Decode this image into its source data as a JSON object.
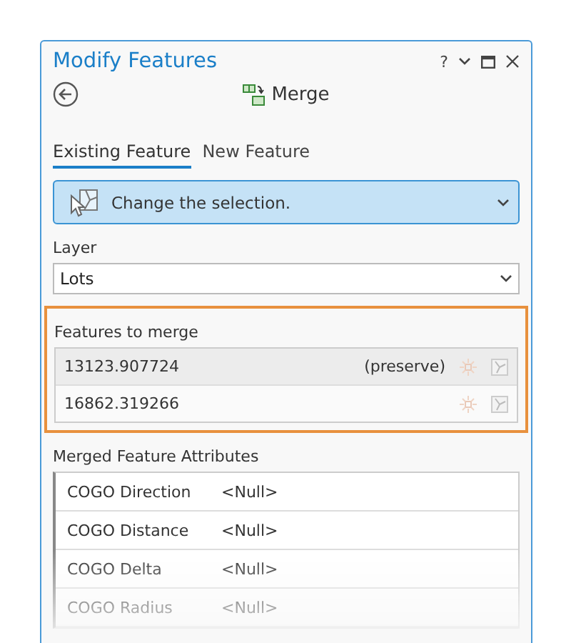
{
  "window": {
    "title": "Modify Features",
    "controls": [
      "?"
    ]
  },
  "tool": {
    "name": "Merge"
  },
  "tabs": [
    {
      "label": "Existing Feature",
      "selected": true
    },
    {
      "label": "New Feature",
      "selected": false
    }
  ],
  "selection_button": {
    "label": "Change the selection."
  },
  "layer": {
    "label": "Layer",
    "value": "Lots"
  },
  "features": {
    "label": "Features to merge",
    "highlighted": true,
    "rows": [
      {
        "id": "13123.907724",
        "note": "(preserve)",
        "selected": true
      },
      {
        "id": "16862.319266",
        "selected": false
      }
    ]
  },
  "attributes": {
    "label": "Merged Feature Attributes",
    "rows": [
      {
        "name": "COGO Direction",
        "value": "<Null>"
      },
      {
        "name": "COGO Distance",
        "value": "<Null>"
      },
      {
        "name": "COGO Delta",
        "value": "<Null>"
      },
      {
        "name": "COGO Radius",
        "value": "<Null>"
      }
    ]
  }
}
